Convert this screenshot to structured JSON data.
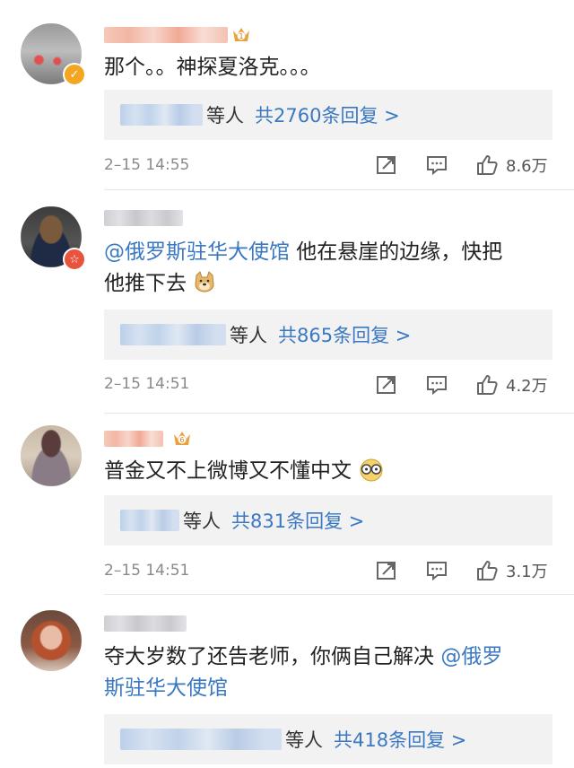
{
  "comments": [
    {
      "text": "那个。。神探夏洛克。。。",
      "reply": {
        "deng": "等人",
        "total": "共2760条回复 >"
      },
      "time": "2–15 14:55",
      "likes": "8.6万",
      "level_badge": "1"
    },
    {
      "mention": "@俄罗斯驻华大使馆",
      "text_line1": " 他在悬崖的边缘，快把",
      "text_line2": "他推下去",
      "emoji": "doge",
      "reply": {
        "deng": "等人",
        "total": "共865条回复 >"
      },
      "time": "2–15 14:51",
      "likes": "4.2万"
    },
    {
      "text": "普金又不上微博又不懂中文",
      "emoji": "glasses-face",
      "reply": {
        "deng": "等人",
        "total": "共831条回复 >"
      },
      "time": "2–15 14:51",
      "likes": "3.1万",
      "level_badge": "6"
    },
    {
      "text_line1": "夺大岁数了还告老师，你俩自己解决 ",
      "mention_line1": "@俄罗",
      "mention_line2": "斯驻华大使馆",
      "reply": {
        "deng": "等人",
        "total": "共418条回复 >"
      }
    }
  ],
  "icons": {
    "share": "share-icon",
    "comment": "comment-icon",
    "like": "thumbs-up-icon"
  },
  "colors": {
    "link": "#3a78c2",
    "meta": "#8a8a8a",
    "reply_bg": "#f2f2f2"
  }
}
